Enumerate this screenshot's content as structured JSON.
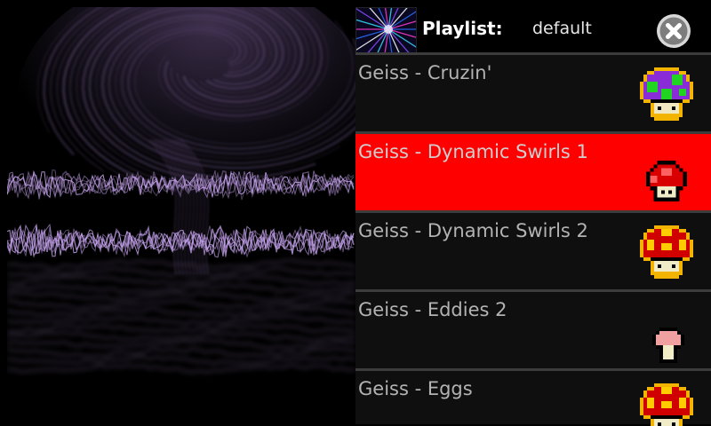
{
  "header": {
    "playlist_label": "Playlist:",
    "playlist_name": "default"
  },
  "presets": [
    {
      "name": "Geiss - Cruzin'",
      "rating_icon": "purple-mushroom-icon",
      "selected": false
    },
    {
      "name": "Geiss - Dynamic Swirls 1",
      "rating_icon": "small-red-mushroom-icon",
      "selected": true
    },
    {
      "name": "Geiss - Dynamic Swirls 2",
      "rating_icon": "red-mushroom-icon",
      "selected": false
    },
    {
      "name": "Geiss - Eddies 2",
      "rating_icon": "tiny-pink-mushroom-icon",
      "selected": false
    },
    {
      "name": "Geiss - Eggs",
      "rating_icon": "red-mushroom-icon",
      "selected": false
    }
  ],
  "colors": {
    "selected_row": "#ff0000",
    "row_background": "#0f0f0f",
    "row_divider": "#3c3c3c",
    "waveform": "#c9a6f2",
    "swirl": "#5a4670"
  }
}
